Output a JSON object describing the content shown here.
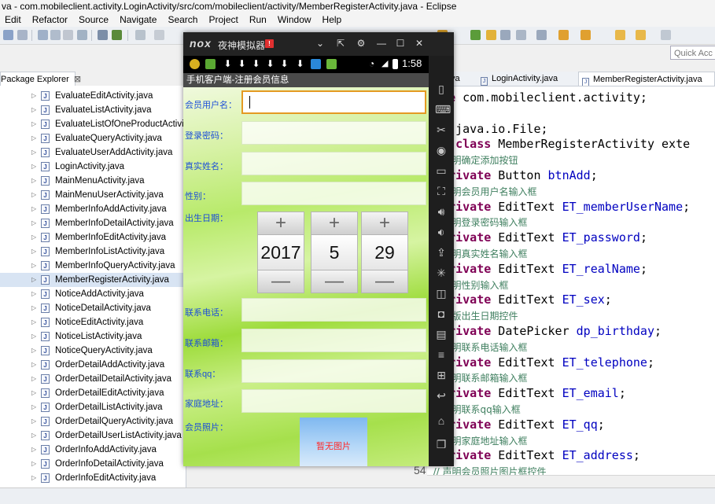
{
  "window": {
    "title": "va - com.mobileclient.activity.LoginActivity/src/com/mobileclient/activity/MemberRegisterActivity.java - Eclipse",
    "menu": [
      "Edit",
      "Refactor",
      "Source",
      "Navigate",
      "Search",
      "Project",
      "Run",
      "Window",
      "Help"
    ],
    "quick_access": "Quick Acc"
  },
  "package_explorer": {
    "tab_label": "Package Explorer",
    "files": [
      "EvaluateEditActivity.java",
      "EvaluateListActivity.java",
      "EvaluateListOfOneProductActivi",
      "EvaluateQueryActivity.java",
      "EvaluateUserAddActivity.java",
      "LoginActivity.java",
      "MainMenuActivity.java",
      "MainMenuUserActivity.java",
      "MemberInfoAddActivity.java",
      "MemberInfoDetailActivity.java",
      "MemberInfoEditActivity.java",
      "MemberInfoListActivity.java",
      "MemberInfoQueryActivity.java",
      "MemberRegisterActivity.java",
      "NoticeAddActivity.java",
      "NoticeDetailActivity.java",
      "NoticeEditActivity.java",
      "NoticeListActivity.java",
      "NoticeQueryActivity.java",
      "OrderDetailAddActivity.java",
      "OrderDetailDetailActivity.java",
      "OrderDetailEditActivity.java",
      "OrderDetailListActivity.java",
      "OrderDetailQueryActivity.java",
      "OrderDetailUserListActivity.java",
      "OrderInfoAddActivity.java",
      "OrderInfoDetailActivity.java",
      "OrderInfoEditActivity.java"
    ],
    "selected_index": 13
  },
  "editor": {
    "tabs": [
      {
        "label": "va",
        "active": false
      },
      {
        "label": "LoginActivity.java",
        "active": false
      },
      {
        "label": "MemberRegisterActivity.java",
        "active": true
      }
    ],
    "code": [
      {
        "kw": "kage",
        "rest": " com.mobileclient.activity;"
      },
      {
        "kw": "",
        "rest": ""
      },
      {
        "kw": "ort",
        "rest": " java.io.File;"
      },
      {
        "kw": "lic class",
        "rest": " MemberRegisterActivity exte"
      },
      {
        "cm": "  // 声明确定添加按钮"
      },
      {
        "kw": "  private",
        "rest": " Button ",
        "fd": "btnAdd",
        "end": ";"
      },
      {
        "cm": "  // 声明会员用户名输入框"
      },
      {
        "kw": "  private",
        "rest": " EditText ",
        "fd": "ET_memberUserName",
        "end": ";"
      },
      {
        "cm": "  // 声明登录密码输入框"
      },
      {
        "kw": "  private",
        "rest": " EditText ",
        "fd": "ET_password",
        "end": ";"
      },
      {
        "cm": "  // 声明真实姓名输入框"
      },
      {
        "kw": "  private",
        "rest": " EditText ",
        "fd": "ET_realName",
        "end": ";"
      },
      {
        "cm": "  // 声明性别输入框"
      },
      {
        "kw": "  private",
        "rest": " EditText ",
        "fd": "ET_sex",
        "end": ";"
      },
      {
        "cm": "  // 出版出生日期控件"
      },
      {
        "kw": "  private",
        "rest": " DatePicker ",
        "fd": "dp_birthday",
        "end": ";"
      },
      {
        "cm": "  // 声明联系电话输入框"
      },
      {
        "kw": "  private",
        "rest": " EditText ",
        "fd": "ET_telephone",
        "end": ";"
      },
      {
        "cm": "  // 声明联系邮箱输入框"
      },
      {
        "kw": "  private",
        "rest": " EditText ",
        "fd": "ET_email",
        "end": ";"
      },
      {
        "cm": "  // 声明联系qq输入框"
      },
      {
        "kw": "  private",
        "rest": " EditText ",
        "fd": "ET_qq",
        "end": ";"
      },
      {
        "cm": "  // 声明家庭地址输入框"
      },
      {
        "kw": "  private",
        "rest": " EditText ",
        "fd": "ET_address",
        "end": ";"
      },
      {
        "cm": "  // 声明会员照片图片框控件"
      }
    ],
    "line_number": "54"
  },
  "emulator": {
    "brand": "nox",
    "title": "夜神模拟器",
    "badge": "!",
    "clock": "1:58",
    "app_title": "手机客户端-注册会员信息",
    "fields": [
      {
        "label": "会员用户名：",
        "focused": true
      },
      {
        "label": "登录密码：",
        "focused": false
      },
      {
        "label": "真实姓名：",
        "focused": false
      },
      {
        "label": "性别：",
        "focused": false
      }
    ],
    "birthday_label": "出生日期：",
    "date": {
      "year": "2017",
      "month": "5",
      "day": "29",
      "plus": "+",
      "minus": "—"
    },
    "fields2": [
      {
        "label": "联系电话："
      },
      {
        "label": "联系邮箱："
      },
      {
        "label": "联系qq："
      },
      {
        "label": "家庭地址："
      }
    ],
    "photo_label": "会员照片：",
    "photo_placeholder": "暂无图片"
  },
  "colors": {
    "label_blue": "#1c4fd8",
    "keyword": "#7f0055",
    "comment": "#3f7f5f",
    "field": "#0000c0"
  }
}
